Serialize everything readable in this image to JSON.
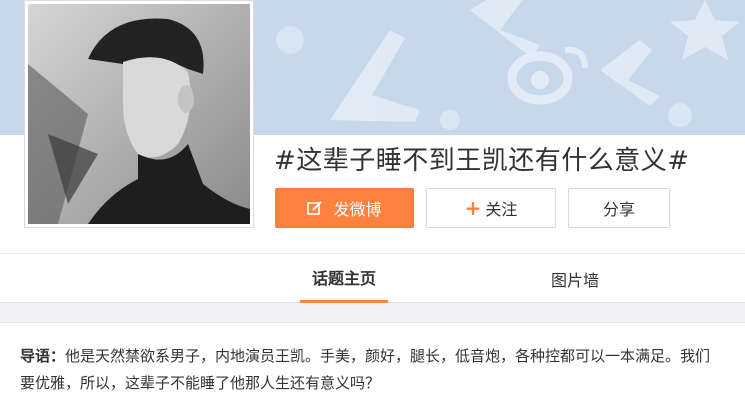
{
  "banner": {
    "background_color": "#c7d8ec",
    "pattern_color": "#e3ecf6",
    "icons": [
      "plane-icon",
      "weibo-logo-icon",
      "star-icon"
    ]
  },
  "avatar": {
    "description_icon": "profile-photo-icon"
  },
  "topic": {
    "title": "#这辈子睡不到王凯还有什么意义#"
  },
  "actions": {
    "post_label": "发微博",
    "follow_label": "关注",
    "share_label": "分享",
    "accent_color": "#ff8140"
  },
  "tabs": [
    {
      "label": "话题主页",
      "active": true
    },
    {
      "label": "图片墙",
      "active": false
    }
  ],
  "intro": {
    "label": "导语：",
    "text": "他是天然禁欲系男子，内地演员王凯。手美，颜好，腿长，低音炮，各种控都可以一本满足。我们要优雅，所以，这辈子不能睡了他那人生还有意义吗？"
  }
}
